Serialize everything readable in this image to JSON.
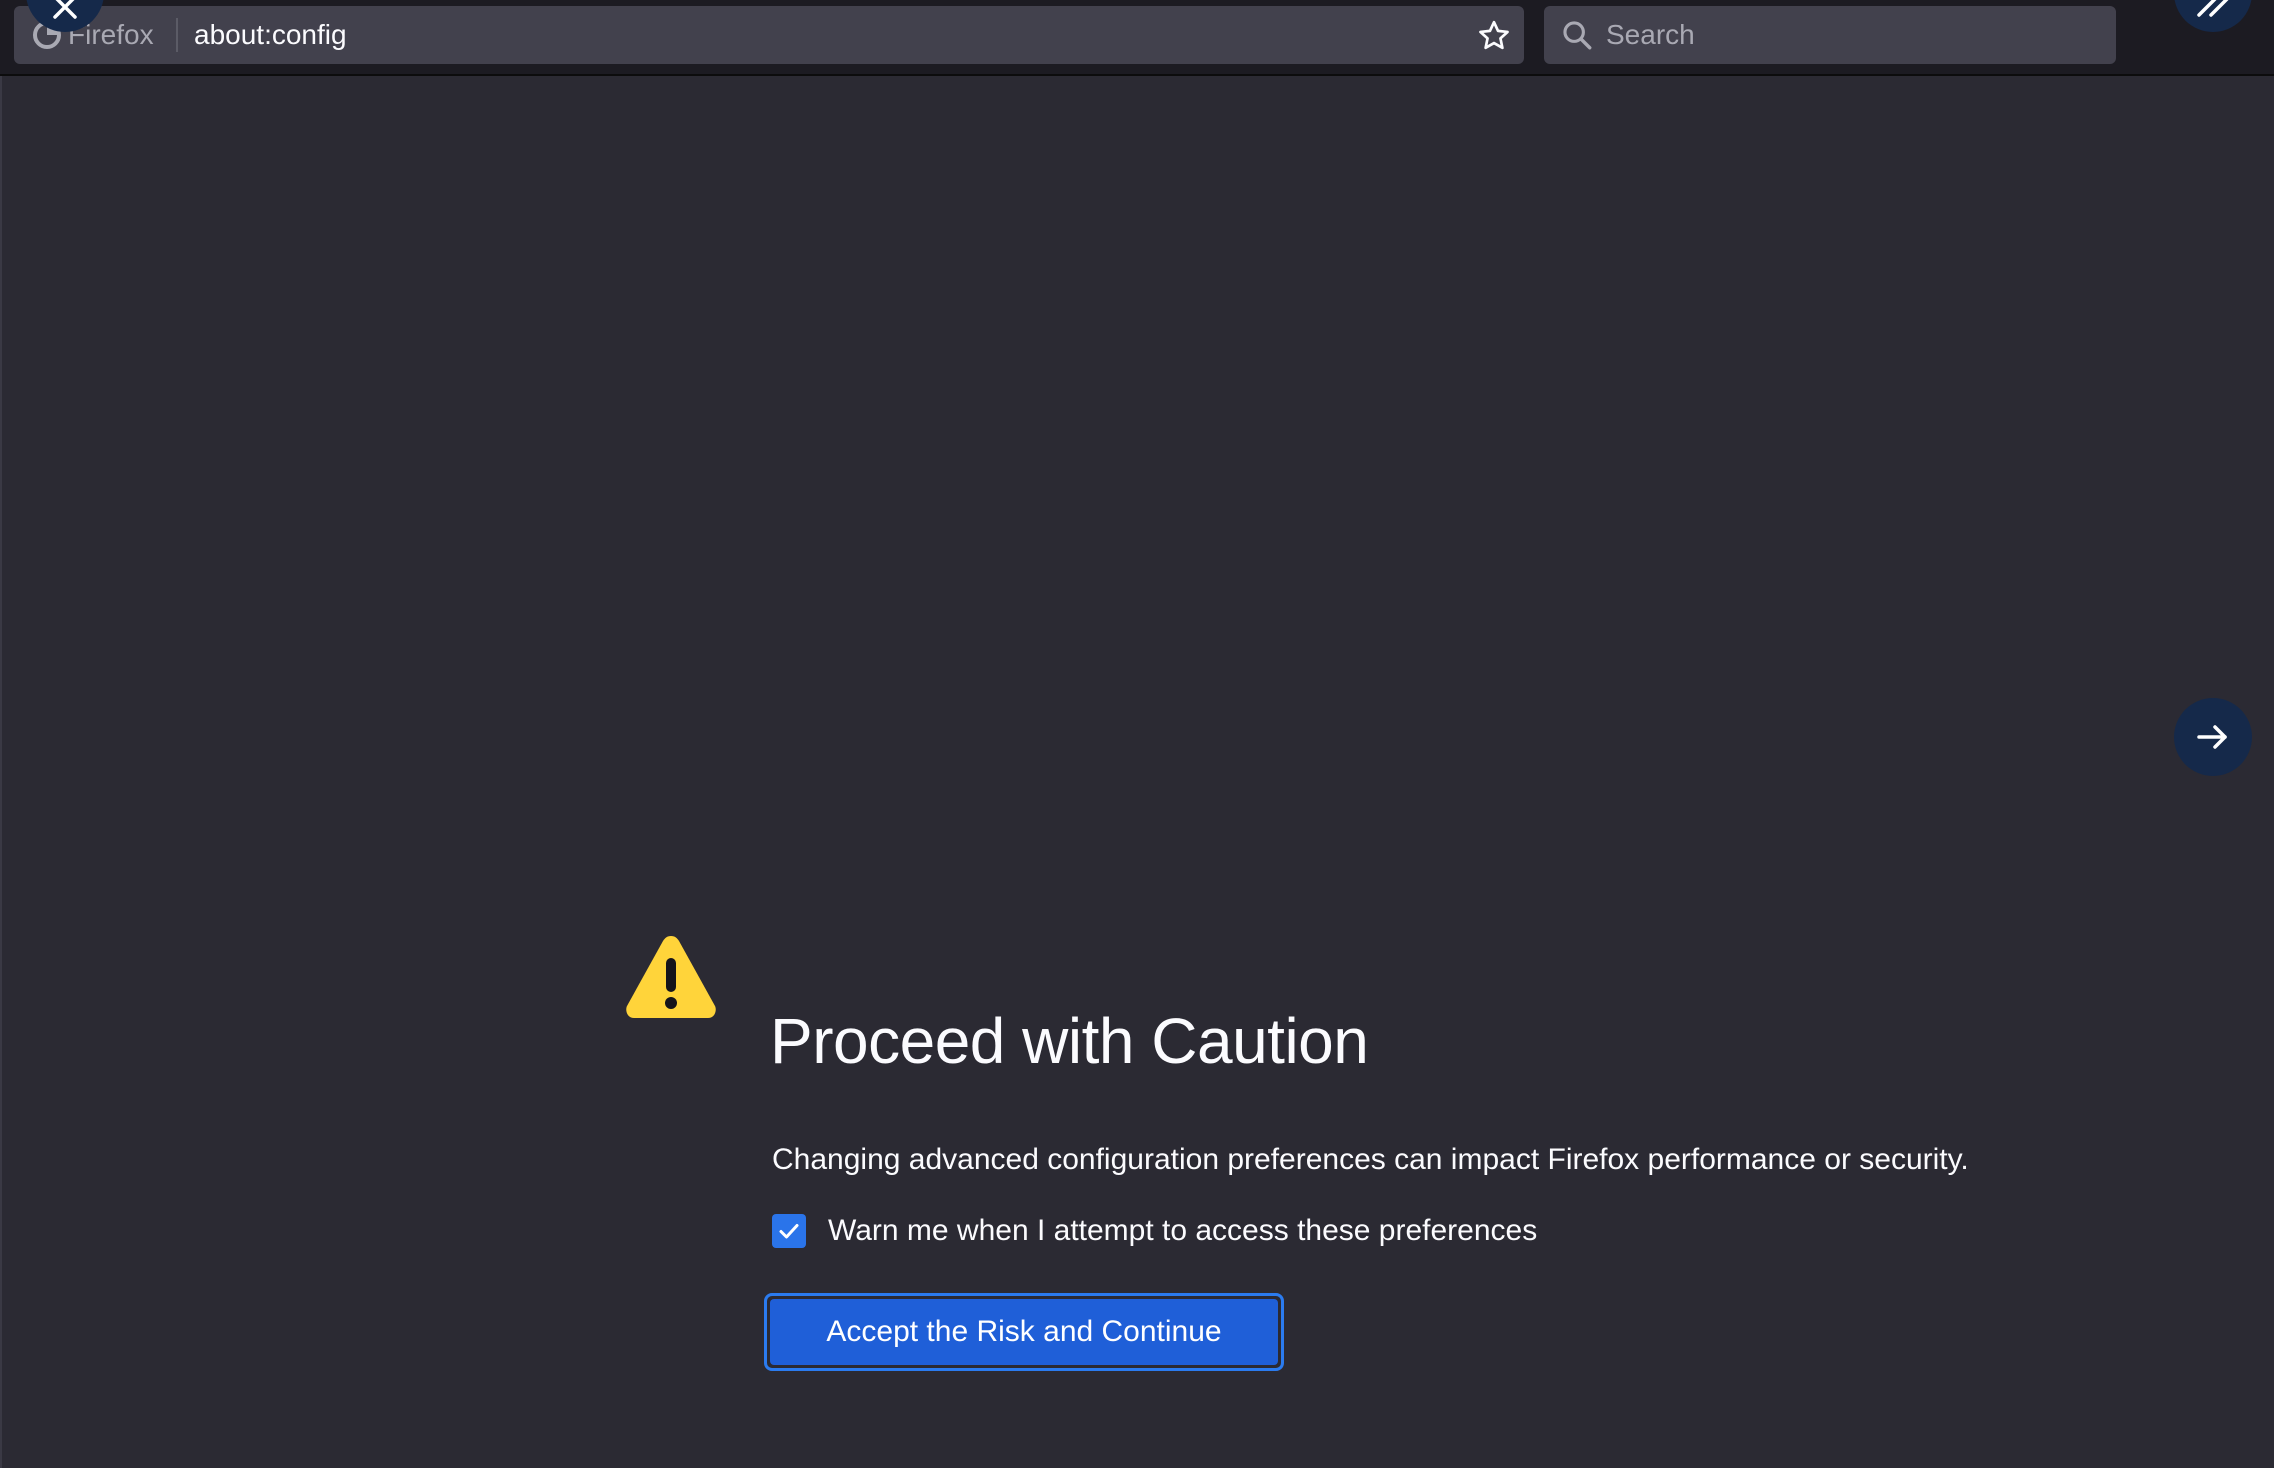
{
  "browser": {
    "identity_label": "Firefox",
    "url": "about:config",
    "search_placeholder": "Search"
  },
  "page": {
    "title": "Proceed with Caution",
    "description": "Changing advanced configuration preferences can impact Firefox performance or security.",
    "checkbox": {
      "label": "Warn me when I attempt to access these preferences",
      "checked": true
    },
    "accept_button_label": "Accept the Risk and Continue"
  },
  "colors": {
    "background": "#2b2a33",
    "toolbar": "#1c1b22",
    "urlbar": "#42414d",
    "accent": "#1f5fd8",
    "warning": "#ffd43a"
  },
  "icons": [
    "close-icon",
    "firefox-logo-icon",
    "star-icon",
    "search-icon",
    "double-chevron-icon",
    "arrow-right-icon",
    "warning-icon",
    "checkmark-icon"
  ]
}
